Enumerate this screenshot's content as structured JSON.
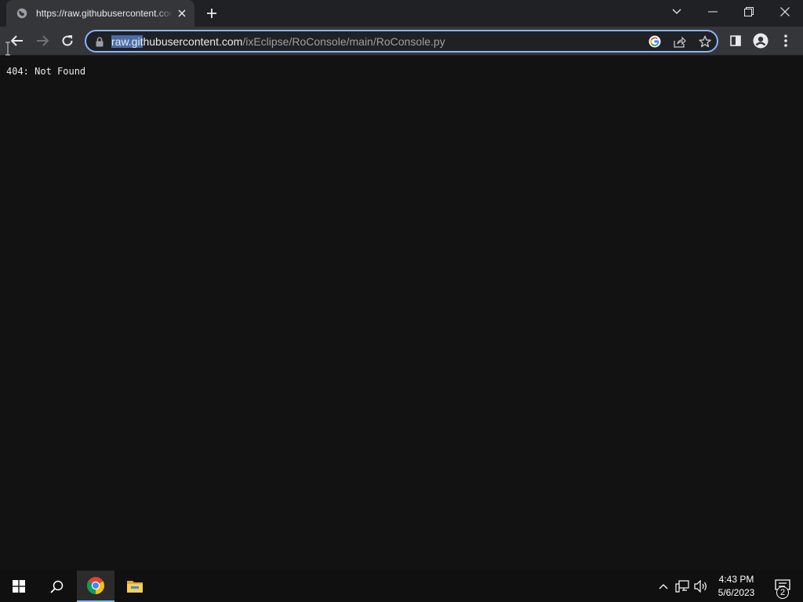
{
  "browser": {
    "tab": {
      "title": "https://raw.githubusercontent.com/ixEclipse/RoConsole/main/RoConsole.py",
      "favicon": "globe-icon"
    },
    "address_bar": {
      "url_selected": "raw.git",
      "url_host_rest": "hubusercontent.com",
      "url_path": "/ixEclipse/RoConsole/main/RoConsole.py"
    },
    "icons": {
      "back": "back-arrow-icon",
      "forward": "forward-arrow-icon",
      "reload": "reload-icon",
      "lock": "lock-icon",
      "google_lens": "google-icon",
      "share": "share-icon",
      "bookmark": "star-icon",
      "side_panel": "side-panel-icon",
      "profile": "profile-icon",
      "menu": "kebab-menu-icon"
    }
  },
  "page": {
    "body_text": "404: Not Found"
  },
  "taskbar": {
    "time": "4:43 PM",
    "date": "5/6/2023",
    "notification_count": "2",
    "apps": [
      "windows-start-icon",
      "search-icon",
      "chrome-icon",
      "file-explorer-icon"
    ]
  },
  "colors": {
    "accent": "#8ab4f8",
    "selection": "#4a6da7",
    "toolbar": "#35363a",
    "tabstrip": "#202124",
    "page_bg": "#121212"
  }
}
